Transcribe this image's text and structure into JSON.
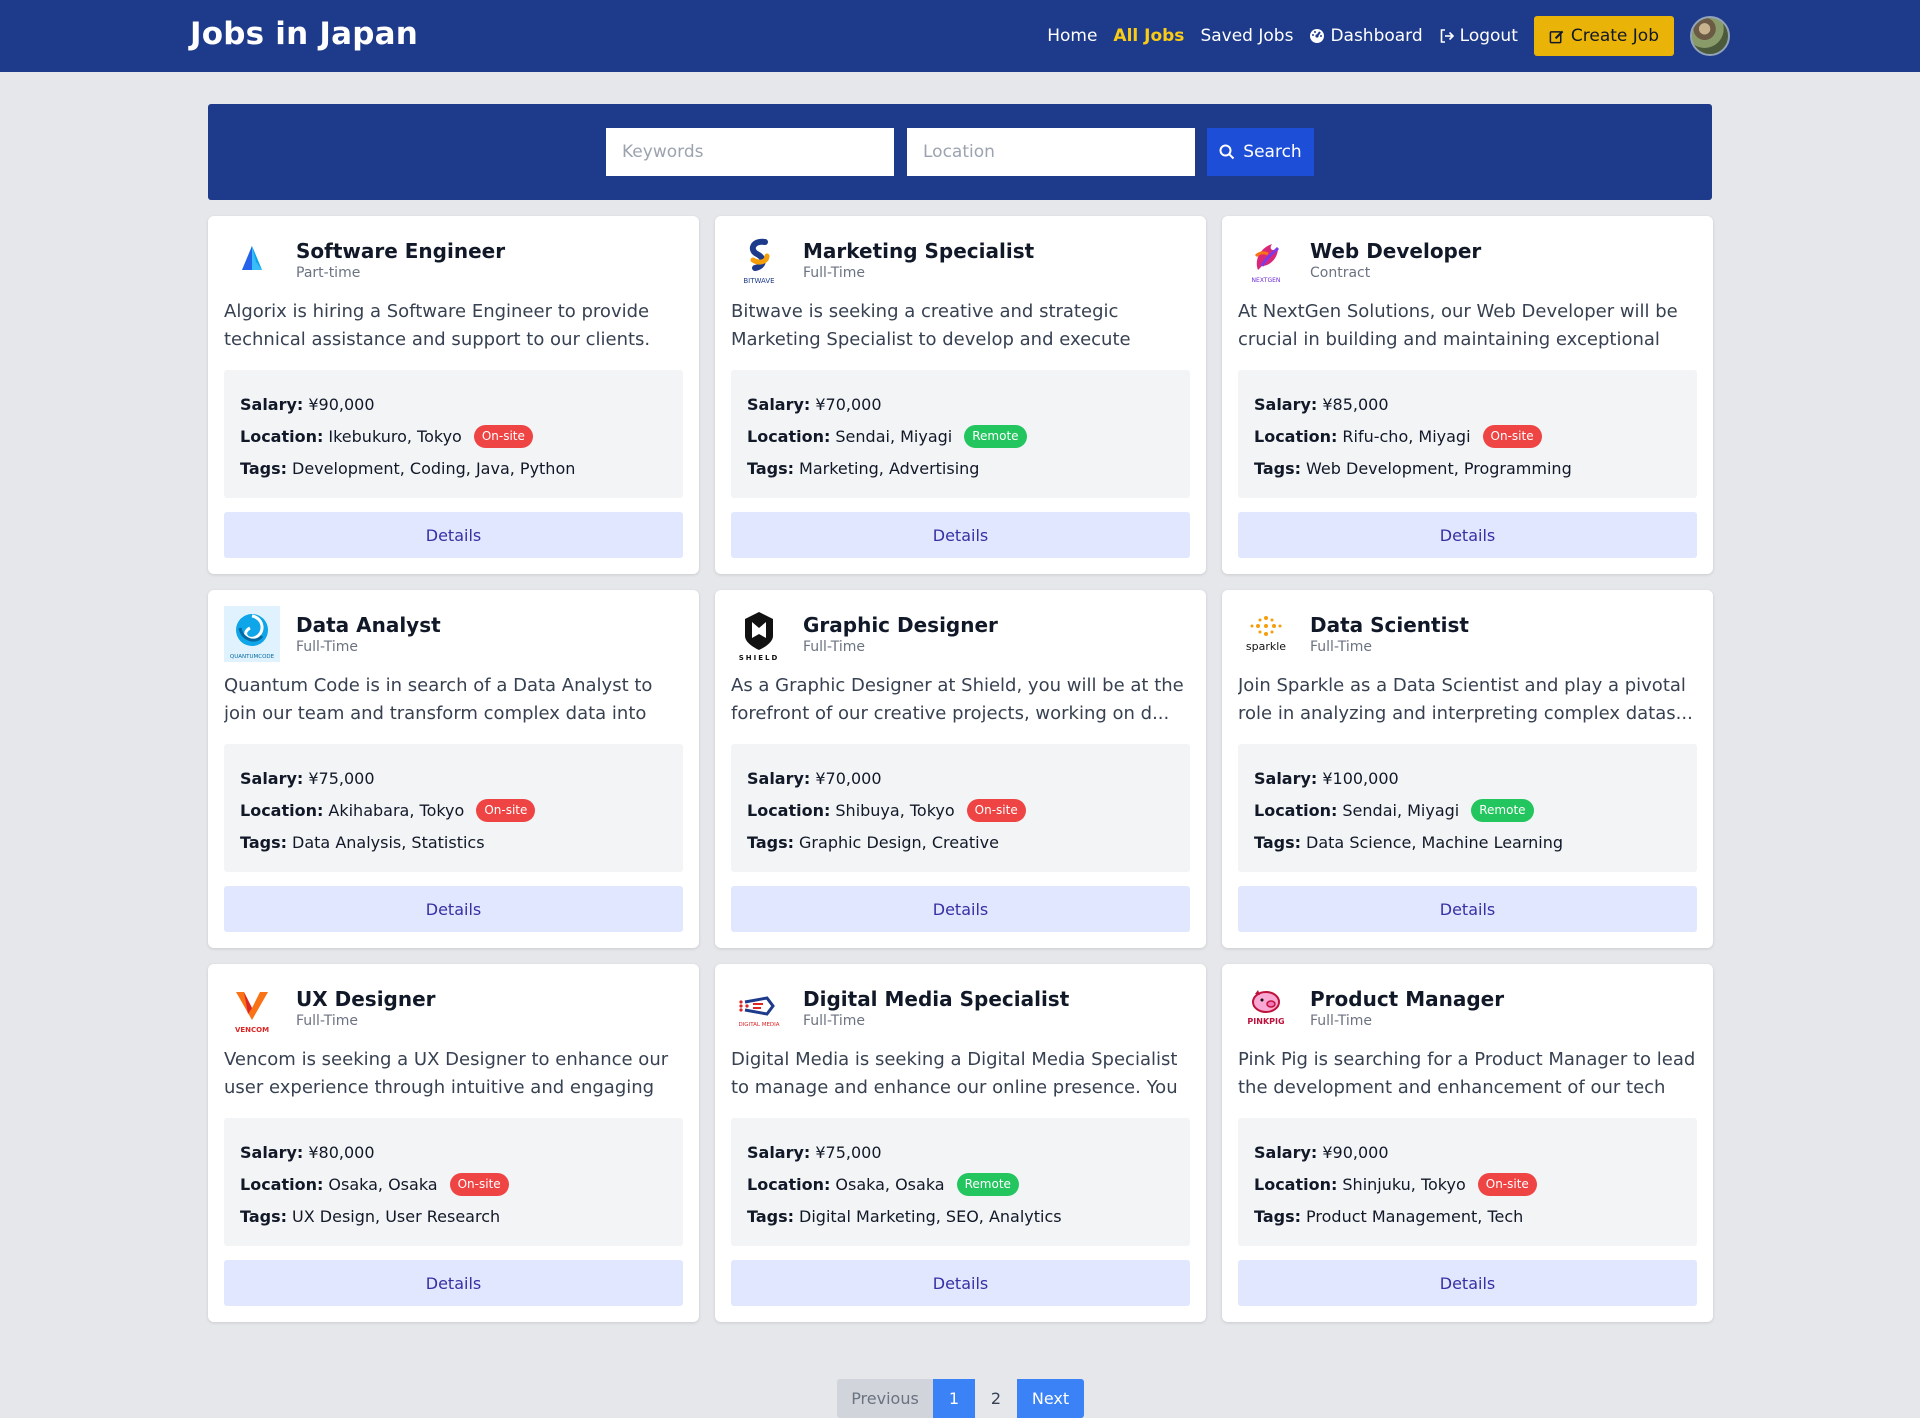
{
  "nav": {
    "brand": "Jobs in Japan",
    "links": [
      "Home",
      "All Jobs",
      "Saved Jobs",
      "Dashboard",
      "Logout"
    ],
    "active": "All Jobs",
    "create": "Create Job",
    "accent": "#facc15"
  },
  "search": {
    "keywords_placeholder": "Keywords",
    "location_placeholder": "Location",
    "button": "Search"
  },
  "labels": {
    "salary": "Salary:",
    "location": "Location:",
    "tags": "Tags:",
    "details": "Details"
  },
  "jobs": [
    {
      "title": "Software Engineer",
      "type": "Part-time",
      "desc": "Algorix is hiring a Software Engineer to provide technical assistance and support to our clients. Yo...",
      "salary": "¥90,000",
      "location": "Ikebukuro, Tokyo",
      "mode": "On-site",
      "tags": "Development, Coding, Java, Python",
      "logo": "algorix-logo"
    },
    {
      "title": "Marketing Specialist",
      "type": "Full-Time",
      "desc": "Bitwave is seeking a creative and strategic Marketing Specialist to develop and execute comprehensiv...",
      "salary": "¥70,000",
      "location": "Sendai, Miyagi",
      "mode": "Remote",
      "tags": "Marketing, Advertising",
      "logo": "bitwave-logo",
      "logo_text": "BITWAVE"
    },
    {
      "title": "Web Developer",
      "type": "Contract",
      "desc": "At NextGen Solutions, our Web Developer will be crucial in building and maintaining exceptional web...",
      "salary": "¥85,000",
      "location": "Rifu-cho, Miyagi",
      "mode": "On-site",
      "tags": "Web Development, Programming",
      "logo": "nextgen-logo",
      "logo_text": "NEXTGEN"
    },
    {
      "title": "Data Analyst",
      "type": "Full-Time",
      "desc": "Quantum Code is in search of a Data Analyst to join our team and transform complex data into actiona...",
      "salary": "¥75,000",
      "location": "Akihabara, Tokyo",
      "mode": "On-site",
      "tags": "Data Analysis, Statistics",
      "logo": "quantumcode-logo",
      "logo_text": "QUANTUMCODE"
    },
    {
      "title": "Graphic Designer",
      "type": "Full-Time",
      "desc": "As a Graphic Designer at Shield, you will be at the forefront of our creative projects, working on d...",
      "salary": "¥70,000",
      "location": "Shibuya, Tokyo",
      "mode": "On-site",
      "tags": "Graphic Design, Creative",
      "logo": "shield-logo",
      "logo_text": "SHIELD"
    },
    {
      "title": "Data Scientist",
      "type": "Full-Time",
      "desc": "Join Sparkle as a Data Scientist and play a pivotal role in analyzing and interpreting complex datas...",
      "salary": "¥100,000",
      "location": "Sendai, Miyagi",
      "mode": "Remote",
      "tags": "Data Science, Machine Learning",
      "logo": "sparkle-logo",
      "logo_text": "sparkle"
    },
    {
      "title": "UX Designer",
      "type": "Full-Time",
      "desc": "Vencom is seeking a UX Designer to enhance our user experience through intuitive and engaging design...",
      "salary": "¥80,000",
      "location": "Osaka, Osaka",
      "mode": "On-site",
      "tags": "UX Design, User Research",
      "logo": "vencom-logo",
      "logo_text": "VENCOM"
    },
    {
      "title": "Digital Media Specialist",
      "type": "Full-Time",
      "desc": "Digital Media is seeking a Digital Media Specialist to manage and enhance our online presence. You w...",
      "salary": "¥75,000",
      "location": "Osaka, Osaka",
      "mode": "Remote",
      "tags": "Digital Marketing, SEO, Analytics",
      "logo": "digitalmedia-logo",
      "logo_text": "DIGITAL MEDIA"
    },
    {
      "title": "Product Manager",
      "type": "Full-Time",
      "desc": "Pink Pig is searching for a Product Manager to lead the development and enhancement of our tech prod...",
      "salary": "¥90,000",
      "location": "Shinjuku, Tokyo",
      "mode": "On-site",
      "tags": "Product Management, Tech",
      "logo": "pinkpig-logo",
      "logo_text": "PINKPIG"
    }
  ],
  "pagination": {
    "prev": "Previous",
    "pages": [
      "1",
      "2"
    ],
    "current": "1",
    "next": "Next"
  },
  "colors": {
    "navbar": "#1e3a8a",
    "onsite": "#ef4444",
    "remote": "#22c55e",
    "primary": "#3b82f6",
    "details_bg": "#e0e7ff"
  }
}
